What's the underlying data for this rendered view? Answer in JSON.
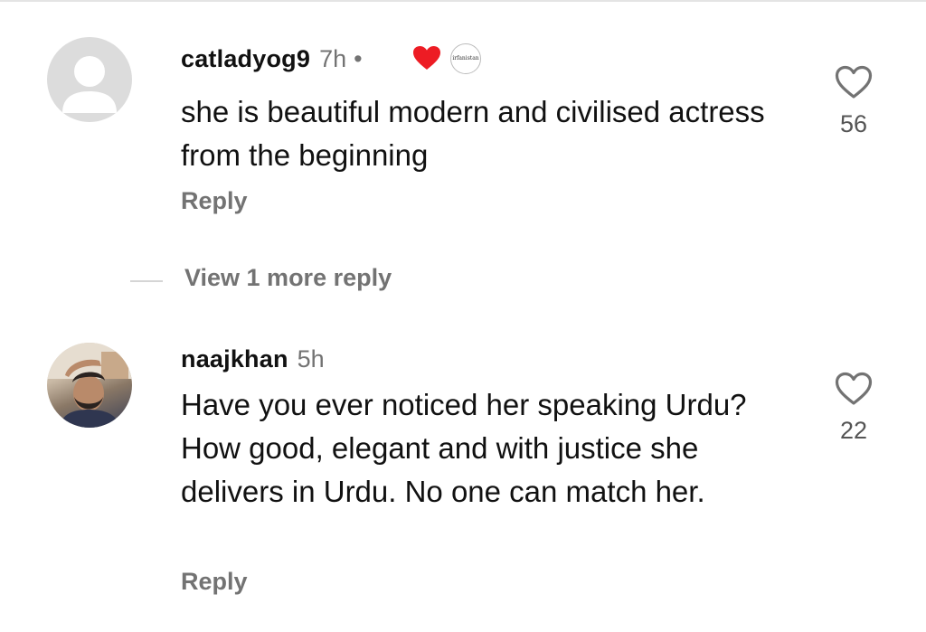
{
  "comments": [
    {
      "username": "catladyog9",
      "time": "7h",
      "separator": "•",
      "creator_liked": true,
      "creator_badge_text": "irfanistan",
      "text": "she is beautiful modern and civilised actress from the beginning",
      "reply_label": "Reply",
      "likes": "56",
      "avatar": "default-avatar"
    },
    {
      "username": "naajkhan",
      "time": "5h",
      "text": "Have you ever noticed her speaking Urdu? How good, elegant and with justice she delivers in Urdu. No one can match her.",
      "reply_label": "Reply",
      "likes": "22",
      "avatar": "photo-avatar"
    }
  ],
  "view_more_replies": "View 1 more reply",
  "colors": {
    "heart_red": "#ed1c24",
    "muted_text": "#737373",
    "divider": "#d5d5d5"
  },
  "icons": {
    "like": "heart-outline-icon",
    "creator_like": "heart-filled-icon"
  }
}
